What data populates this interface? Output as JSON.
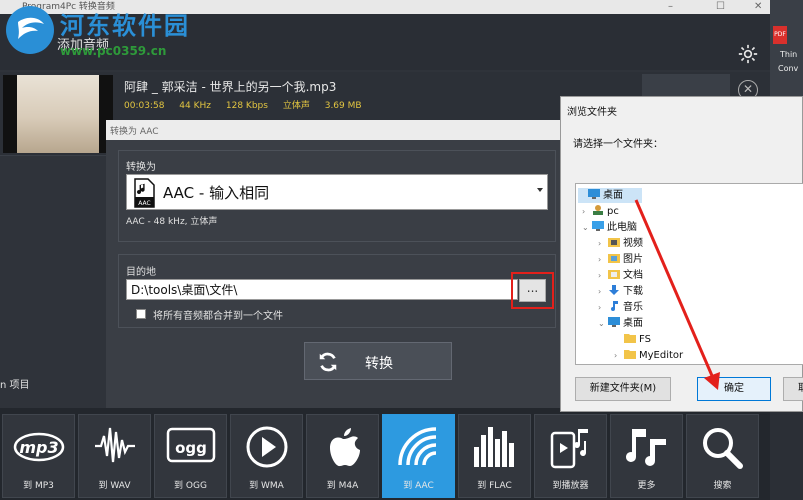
{
  "window": {
    "title": "Program4Pc 转换音频",
    "min": "–",
    "max": "☐",
    "close": "✕"
  },
  "watermark": {
    "brand": "河东软件园",
    "url": "www.pc0359.cn"
  },
  "header": {
    "add_audio_label": "添加音频"
  },
  "file": {
    "name": "阿肆 _ 郭采洁 - 世界上的另一个我.mp3",
    "duration": "00:03:58",
    "sample_rate": "44 KHz",
    "bitrate": "128 Kbps",
    "channels": "立体声",
    "size": "3.69 MB"
  },
  "left_panel": {
    "items_label": "n 项目"
  },
  "convert_panel": {
    "title": "转换为 AAC",
    "convert_to_label": "转换为",
    "format_selected": "AAC - 输入相同",
    "format_icon_label": "AAC",
    "format_desc": "AAC - 48 kHz, 立体声",
    "destination_label": "目的地",
    "destination_path": "D:\\tools\\桌面\\文件\\",
    "browse_label": "...",
    "merge_label": "将所有音频都合并到一个文件",
    "convert_button": "转换"
  },
  "formats": [
    {
      "label": "到 MP3",
      "icon": "mp3-icon"
    },
    {
      "label": "到 WAV",
      "icon": "wave-icon"
    },
    {
      "label": "到 OGG",
      "icon": "ogg-icon"
    },
    {
      "label": "到 WMA",
      "icon": "play-icon"
    },
    {
      "label": "到 M4A",
      "icon": "apple-icon"
    },
    {
      "label": "到 AAC",
      "icon": "aac-icon",
      "active": true
    },
    {
      "label": "到 FLAC",
      "icon": "flac-bars-icon"
    },
    {
      "label": "到播放器",
      "icon": "phone-music-icon"
    },
    {
      "label": "更多",
      "icon": "music-notes-icon"
    },
    {
      "label": "搜索",
      "icon": "search-icon"
    }
  ],
  "dialog": {
    "title": "浏览文件夹",
    "prompt": "请选择一个文件夹：",
    "tree": [
      "桌面",
      "pc",
      "此电脑",
      "视频",
      "图片",
      "文档",
      "下载",
      "音乐",
      "桌面",
      "FS",
      "MyEditor"
    ],
    "new_folder": "新建文件夹(M)",
    "ok": "确定",
    "cancel": "取"
  },
  "desktop": {
    "pdf": "PDF",
    "text1": "Thin",
    "text2": "Conv"
  },
  "colors": {
    "accent": "#2d9ae0",
    "highlight": "#e3201b",
    "meta": "#e2c541"
  }
}
